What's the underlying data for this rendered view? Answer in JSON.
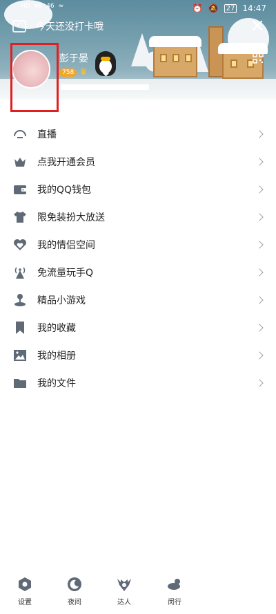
{
  "status_bar": {
    "left_tags": [
      "HD",
      "46",
      "46"
    ],
    "battery": "27",
    "time": "14:47"
  },
  "header": {
    "checkin_text": "今天还没打卡哦",
    "nickname": "彭于晏",
    "level": "758"
  },
  "menu": {
    "items": [
      {
        "label": "直播",
        "icon": "live-icon"
      },
      {
        "label": "点我开通会员",
        "icon": "crown-icon"
      },
      {
        "label": "我的QQ钱包",
        "icon": "wallet-icon"
      },
      {
        "label": "限免装扮大放送",
        "icon": "shirt-icon"
      },
      {
        "label": "我的情侣空间",
        "icon": "heart-icon"
      },
      {
        "label": "免流量玩手Q",
        "icon": "signal-tower-icon"
      },
      {
        "label": "精品小游戏",
        "icon": "joystick-icon"
      },
      {
        "label": "我的收藏",
        "icon": "bookmark-icon"
      },
      {
        "label": "我的相册",
        "icon": "image-icon"
      },
      {
        "label": "我的文件",
        "icon": "folder-icon"
      }
    ]
  },
  "bottom_bar": {
    "items": [
      {
        "label": "设置",
        "icon": "gear-icon"
      },
      {
        "label": "夜间",
        "icon": "moon-icon"
      },
      {
        "label": "达人",
        "icon": "talent-badge-icon"
      },
      {
        "label": "闵行",
        "icon": "weather-icon"
      }
    ]
  },
  "colors": {
    "icon_gray": "#5f6a76",
    "highlight_box": "#e02020",
    "header_sky": "#6f99a9"
  }
}
